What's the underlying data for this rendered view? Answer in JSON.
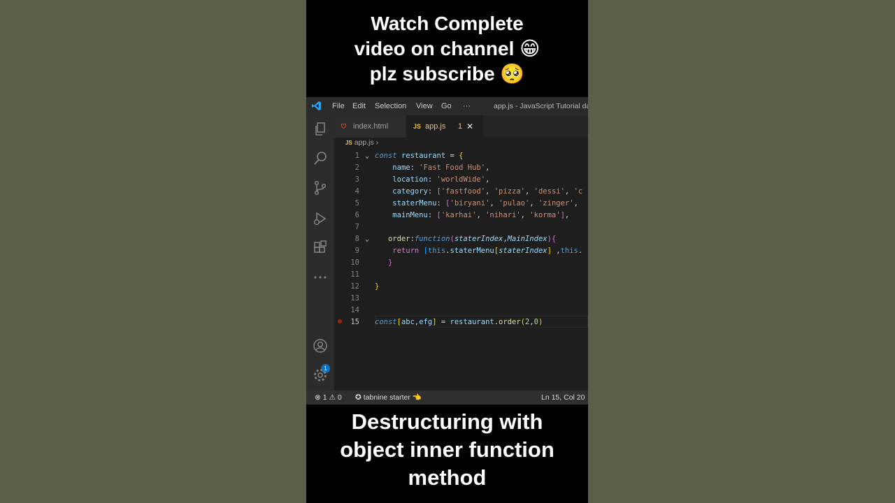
{
  "captions": {
    "top": [
      "Watch Complete",
      "video on channel 😁",
      "plz subscribe 🥺"
    ],
    "bottom": [
      "Destructuring with",
      "object inner function",
      "method"
    ]
  },
  "titlebar": {
    "menus": [
      "File",
      "Edit",
      "Selection",
      "View",
      "Go",
      "···"
    ],
    "window_title": "app.js - JavaScript Tutorial day"
  },
  "tabs": [
    {
      "label": "index.html",
      "icon": "html-file-icon"
    },
    {
      "label": "app.js",
      "icon": "js-file-icon",
      "problems": "1",
      "close": "✕"
    }
  ],
  "breadcrumb": {
    "file": "app.js",
    "separator": "›"
  },
  "editor": {
    "line_numbers": [
      "1",
      "2",
      "3",
      "4",
      "5",
      "6",
      "7",
      "8",
      "9",
      "10",
      "11",
      "12",
      "13",
      "14",
      "15"
    ],
    "active_line": "15"
  },
  "statusbar": {
    "errors": "1",
    "warnings": "0",
    "tabnine": "tabnine starter",
    "cursor": "Ln 15, Col 20"
  },
  "activity_bar": {
    "accounts_badge": "1"
  },
  "colors": {
    "background": "#1e1e1e",
    "accent": "#0e70c0",
    "string": "#ce9178",
    "keyword": "#569cd6"
  }
}
